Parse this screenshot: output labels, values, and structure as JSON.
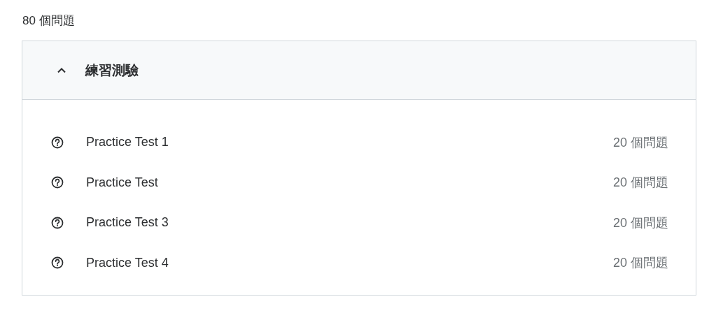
{
  "summary": "80 個問題",
  "section": {
    "title": "練習測驗",
    "expanded": true,
    "items": [
      {
        "title": "Practice Test 1",
        "count": "20 個問題"
      },
      {
        "title": "Practice Test",
        "count": "20 個問題"
      },
      {
        "title": "Practice Test 3",
        "count": "20 個問題"
      },
      {
        "title": "Practice Test 4",
        "count": "20 個問題"
      }
    ]
  }
}
